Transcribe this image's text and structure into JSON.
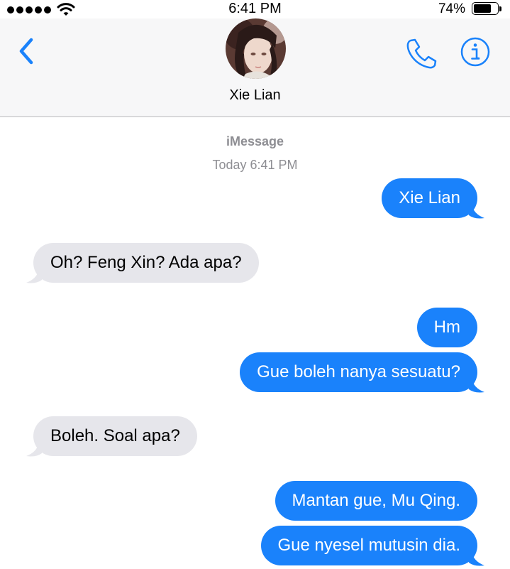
{
  "status_bar": {
    "time": "6:41 PM",
    "battery_percent": "74%",
    "battery_level": 0.74
  },
  "header": {
    "contact_name": "Xie Lian",
    "back_icon": "chevron-left-icon",
    "call_icon": "phone-icon",
    "info_icon": "info-icon"
  },
  "conversation": {
    "service": "iMessage",
    "timestamp": "Today 6:41 PM",
    "messages": [
      {
        "direction": "outgoing",
        "text": "Xie Lian",
        "tail": true
      },
      {
        "direction": "incoming",
        "text": "Oh? Feng Xin? Ada apa?",
        "tail": true
      },
      {
        "direction": "outgoing",
        "text": "Hm",
        "tail": false
      },
      {
        "direction": "outgoing",
        "text": "Gue boleh nanya sesuatu?",
        "tail": true
      },
      {
        "direction": "incoming",
        "text": "Boleh. Soal apa?",
        "tail": true
      },
      {
        "direction": "outgoing",
        "text": "Mantan gue, Mu Qing.",
        "tail": false
      },
      {
        "direction": "outgoing",
        "text": "Gue nyesel mutusin dia.",
        "tail": true
      }
    ]
  },
  "colors": {
    "outgoing_bubble": "#1a82fb",
    "incoming_bubble": "#e6e6eb",
    "accent": "#1a82fb",
    "meta_text": "#8e8e93"
  }
}
